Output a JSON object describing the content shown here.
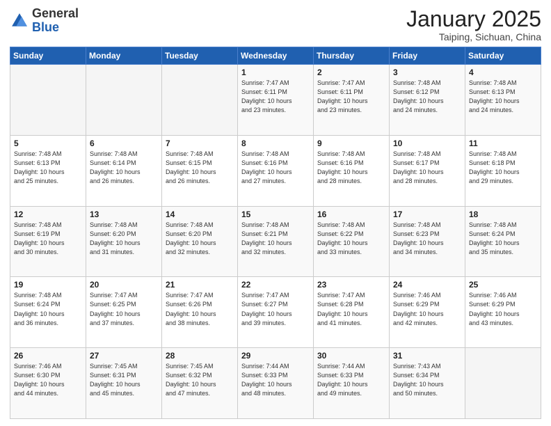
{
  "header": {
    "logo_general": "General",
    "logo_blue": "Blue",
    "title": "January 2025",
    "subtitle": "Taiping, Sichuan, China"
  },
  "weekdays": [
    "Sunday",
    "Monday",
    "Tuesday",
    "Wednesday",
    "Thursday",
    "Friday",
    "Saturday"
  ],
  "weeks": [
    [
      {
        "day": "",
        "info": ""
      },
      {
        "day": "",
        "info": ""
      },
      {
        "day": "",
        "info": ""
      },
      {
        "day": "1",
        "info": "Sunrise: 7:47 AM\nSunset: 6:11 PM\nDaylight: 10 hours\nand 23 minutes."
      },
      {
        "day": "2",
        "info": "Sunrise: 7:47 AM\nSunset: 6:11 PM\nDaylight: 10 hours\nand 23 minutes."
      },
      {
        "day": "3",
        "info": "Sunrise: 7:48 AM\nSunset: 6:12 PM\nDaylight: 10 hours\nand 24 minutes."
      },
      {
        "day": "4",
        "info": "Sunrise: 7:48 AM\nSunset: 6:13 PM\nDaylight: 10 hours\nand 24 minutes."
      }
    ],
    [
      {
        "day": "5",
        "info": "Sunrise: 7:48 AM\nSunset: 6:13 PM\nDaylight: 10 hours\nand 25 minutes."
      },
      {
        "day": "6",
        "info": "Sunrise: 7:48 AM\nSunset: 6:14 PM\nDaylight: 10 hours\nand 26 minutes."
      },
      {
        "day": "7",
        "info": "Sunrise: 7:48 AM\nSunset: 6:15 PM\nDaylight: 10 hours\nand 26 minutes."
      },
      {
        "day": "8",
        "info": "Sunrise: 7:48 AM\nSunset: 6:16 PM\nDaylight: 10 hours\nand 27 minutes."
      },
      {
        "day": "9",
        "info": "Sunrise: 7:48 AM\nSunset: 6:16 PM\nDaylight: 10 hours\nand 28 minutes."
      },
      {
        "day": "10",
        "info": "Sunrise: 7:48 AM\nSunset: 6:17 PM\nDaylight: 10 hours\nand 28 minutes."
      },
      {
        "day": "11",
        "info": "Sunrise: 7:48 AM\nSunset: 6:18 PM\nDaylight: 10 hours\nand 29 minutes."
      }
    ],
    [
      {
        "day": "12",
        "info": "Sunrise: 7:48 AM\nSunset: 6:19 PM\nDaylight: 10 hours\nand 30 minutes."
      },
      {
        "day": "13",
        "info": "Sunrise: 7:48 AM\nSunset: 6:20 PM\nDaylight: 10 hours\nand 31 minutes."
      },
      {
        "day": "14",
        "info": "Sunrise: 7:48 AM\nSunset: 6:20 PM\nDaylight: 10 hours\nand 32 minutes."
      },
      {
        "day": "15",
        "info": "Sunrise: 7:48 AM\nSunset: 6:21 PM\nDaylight: 10 hours\nand 32 minutes."
      },
      {
        "day": "16",
        "info": "Sunrise: 7:48 AM\nSunset: 6:22 PM\nDaylight: 10 hours\nand 33 minutes."
      },
      {
        "day": "17",
        "info": "Sunrise: 7:48 AM\nSunset: 6:23 PM\nDaylight: 10 hours\nand 34 minutes."
      },
      {
        "day": "18",
        "info": "Sunrise: 7:48 AM\nSunset: 6:24 PM\nDaylight: 10 hours\nand 35 minutes."
      }
    ],
    [
      {
        "day": "19",
        "info": "Sunrise: 7:48 AM\nSunset: 6:24 PM\nDaylight: 10 hours\nand 36 minutes."
      },
      {
        "day": "20",
        "info": "Sunrise: 7:47 AM\nSunset: 6:25 PM\nDaylight: 10 hours\nand 37 minutes."
      },
      {
        "day": "21",
        "info": "Sunrise: 7:47 AM\nSunset: 6:26 PM\nDaylight: 10 hours\nand 38 minutes."
      },
      {
        "day": "22",
        "info": "Sunrise: 7:47 AM\nSunset: 6:27 PM\nDaylight: 10 hours\nand 39 minutes."
      },
      {
        "day": "23",
        "info": "Sunrise: 7:47 AM\nSunset: 6:28 PM\nDaylight: 10 hours\nand 41 minutes."
      },
      {
        "day": "24",
        "info": "Sunrise: 7:46 AM\nSunset: 6:29 PM\nDaylight: 10 hours\nand 42 minutes."
      },
      {
        "day": "25",
        "info": "Sunrise: 7:46 AM\nSunset: 6:29 PM\nDaylight: 10 hours\nand 43 minutes."
      }
    ],
    [
      {
        "day": "26",
        "info": "Sunrise: 7:46 AM\nSunset: 6:30 PM\nDaylight: 10 hours\nand 44 minutes."
      },
      {
        "day": "27",
        "info": "Sunrise: 7:45 AM\nSunset: 6:31 PM\nDaylight: 10 hours\nand 45 minutes."
      },
      {
        "day": "28",
        "info": "Sunrise: 7:45 AM\nSunset: 6:32 PM\nDaylight: 10 hours\nand 47 minutes."
      },
      {
        "day": "29",
        "info": "Sunrise: 7:44 AM\nSunset: 6:33 PM\nDaylight: 10 hours\nand 48 minutes."
      },
      {
        "day": "30",
        "info": "Sunrise: 7:44 AM\nSunset: 6:33 PM\nDaylight: 10 hours\nand 49 minutes."
      },
      {
        "day": "31",
        "info": "Sunrise: 7:43 AM\nSunset: 6:34 PM\nDaylight: 10 hours\nand 50 minutes."
      },
      {
        "day": "",
        "info": ""
      }
    ]
  ]
}
